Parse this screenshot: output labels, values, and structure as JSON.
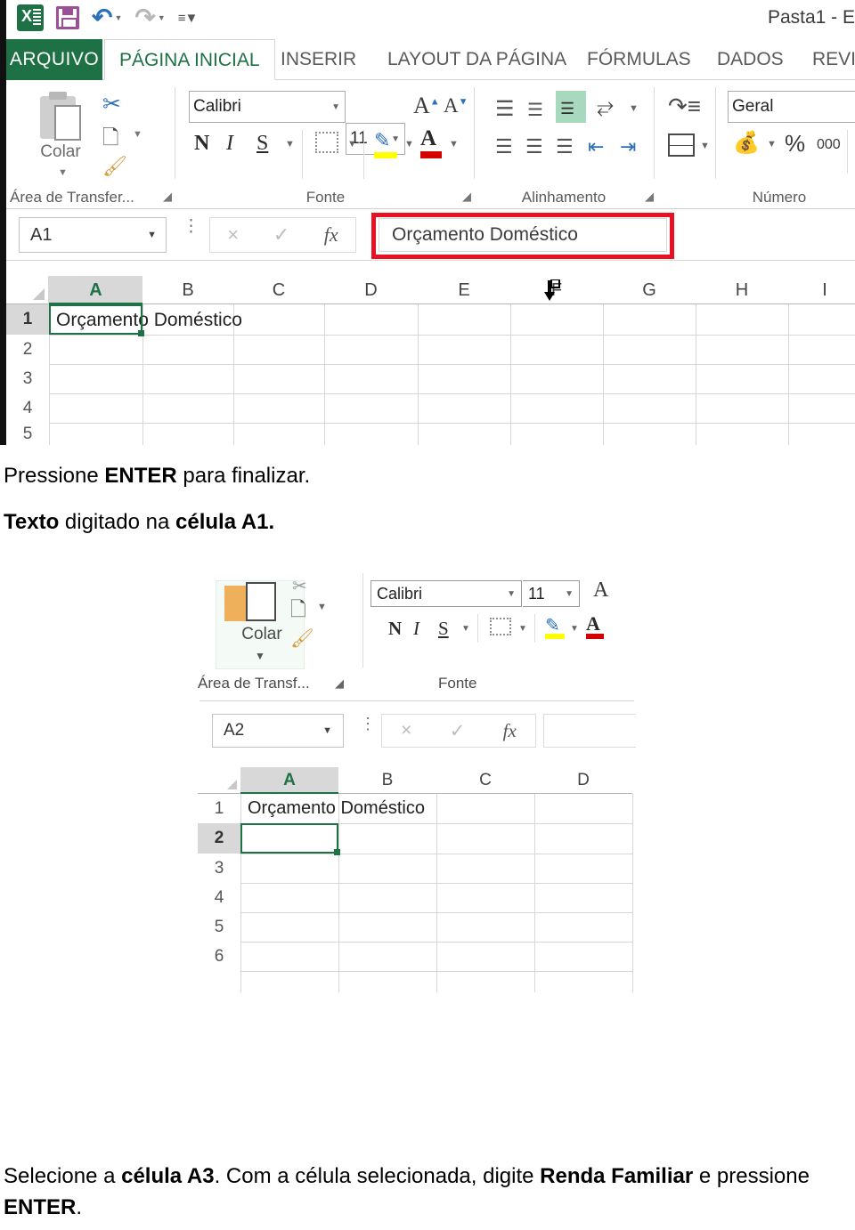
{
  "document": {
    "paragraphs": [
      {
        "id": "p1",
        "segments": [
          {
            "t": "Pressione ",
            "b": false
          },
          {
            "t": "ENTER",
            "b": true
          },
          {
            "t": " para finalizar.",
            "b": false
          }
        ]
      },
      {
        "id": "p2",
        "segments": [
          {
            "t": "Texto",
            "b": true
          },
          {
            "t": " digitado na ",
            "b": false
          },
          {
            "t": "célula A1.",
            "b": true
          }
        ]
      },
      {
        "id": "p3",
        "segments": [
          {
            "t": "Selecione a ",
            "b": false
          },
          {
            "t": "célula A3",
            "b": true
          },
          {
            "t": ". Com a célula selecionada, digite ",
            "b": false
          },
          {
            "t": "Renda Familiar",
            "b": true
          },
          {
            "t": " e pressione ",
            "b": false
          },
          {
            "t": "ENTER",
            "b": true
          },
          {
            "t": ".",
            "b": false
          }
        ]
      }
    ]
  },
  "screenshot1": {
    "window_title": "Pasta1 - E",
    "quick_access": [
      {
        "name": "excel-logo",
        "label": "X"
      },
      {
        "name": "save-icon",
        "label": "Salvar"
      },
      {
        "name": "undo-icon",
        "label": "Desfazer"
      },
      {
        "name": "redo-icon",
        "label": "Refazer"
      },
      {
        "name": "customize-qat-icon",
        "label": "Personalizar"
      }
    ],
    "tabs": [
      {
        "label": "ARQUIVO",
        "active": false,
        "file": true
      },
      {
        "label": "PÁGINA INICIAL",
        "active": true
      },
      {
        "label": "INSERIR",
        "active": false
      },
      {
        "label": "LAYOUT DA PÁGINA",
        "active": false
      },
      {
        "label": "FÓRMULAS",
        "active": false
      },
      {
        "label": "DADOS",
        "active": false
      },
      {
        "label": "REVIS",
        "active": false
      }
    ],
    "groups": {
      "clipboard": {
        "label": "Área de Transfer...",
        "paste_label": "Colar",
        "buttons": [
          "recortar",
          "copiar",
          "pincel-de-formatacao"
        ]
      },
      "font": {
        "label": "Fonte",
        "font_name": "Calibri",
        "font_size": "11",
        "buttons": [
          "N",
          "I",
          "S"
        ],
        "grow": "A",
        "shrink": "A"
      },
      "alignment": {
        "label": "Alinhamento"
      },
      "number": {
        "label": "Número",
        "format": "Geral",
        "percent": "%",
        "thousands": "000"
      }
    },
    "formula_bar": {
      "name_box": "A1",
      "cancel_icon": "×",
      "confirm_icon": "✓",
      "function_icon": "fx",
      "value": "Orçamento Doméstico",
      "highlight_color": "#e81123"
    },
    "sheet": {
      "columns": [
        "A",
        "B",
        "C",
        "D",
        "E",
        "F",
        "G",
        "H",
        "I"
      ],
      "rows": [
        "1",
        "2",
        "3",
        "4",
        "5"
      ],
      "selected_cell": "A1",
      "selected_column": "A",
      "cells": [
        {
          "ref": "A1",
          "value": "Orçamento Doméstico"
        }
      ],
      "cursor_on_column": "F"
    }
  },
  "screenshot2": {
    "groups": {
      "clipboard": {
        "label": "Área de Transf...",
        "paste_label": "Colar"
      },
      "font": {
        "label": "Fonte",
        "font_name": "Calibri",
        "font_size": "11",
        "buttons": [
          "N",
          "I",
          "S"
        ],
        "grow": "A"
      }
    },
    "formula_bar": {
      "name_box": "A2",
      "cancel_icon": "×",
      "confirm_icon": "✓",
      "function_icon": "fx",
      "value": ""
    },
    "sheet": {
      "columns": [
        "A",
        "B",
        "C",
        "D"
      ],
      "rows": [
        "1",
        "2",
        "3",
        "4",
        "5",
        "6"
      ],
      "selected_cell": "A2",
      "selected_column": "A",
      "cells": [
        {
          "ref": "A1",
          "value": "Orçamento Doméstico"
        }
      ]
    }
  }
}
